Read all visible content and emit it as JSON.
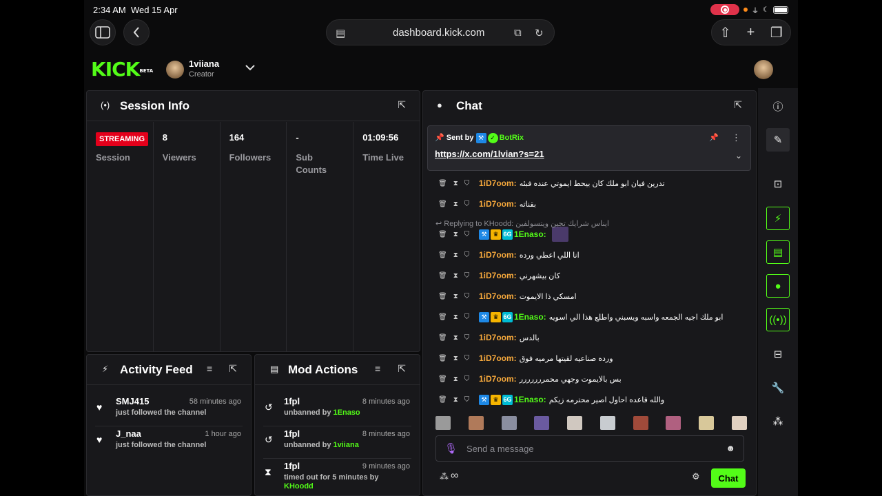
{
  "status": {
    "time": "2:34 AM",
    "date": "Wed 15 Apr"
  },
  "browser": {
    "url": "dashboard.kick.com"
  },
  "brand": {
    "logo": "KICK",
    "beta": "BETA"
  },
  "user": {
    "name": "1viiana",
    "role": "Creator"
  },
  "session": {
    "title": "Session Info",
    "stats": [
      {
        "value": "STREAMING",
        "label": "Session"
      },
      {
        "value": "8",
        "label": "Viewers"
      },
      {
        "value": "164",
        "label": "Followers"
      },
      {
        "value": "-",
        "label": "Sub Counts"
      },
      {
        "value": "01:09:56",
        "label": "Time Live"
      }
    ]
  },
  "activity": {
    "title": "Activity Feed",
    "items": [
      {
        "name": "SMJ415",
        "time": "58 minutes ago",
        "text": "just followed the channel"
      },
      {
        "name": "J_naa",
        "time": "1 hour ago",
        "text": "just followed the channel"
      }
    ]
  },
  "mod": {
    "title": "Mod Actions",
    "items": [
      {
        "name": "1fpl",
        "time": "8 minutes ago",
        "text": "unbanned by",
        "by": "1Enaso"
      },
      {
        "name": "1fpl",
        "time": "8 minutes ago",
        "text": "unbanned by",
        "by": "1viiana"
      },
      {
        "name": "1fpl",
        "time": "9 minutes ago",
        "text": "timed out for 5 minutes by",
        "by": "KHoodd"
      }
    ]
  },
  "chat": {
    "title": "Chat",
    "pinned": {
      "sent_by": "Sent by",
      "author": "BotRix",
      "link": "https://x.com/1lvian?s=21"
    },
    "reply_to": "Replying to KHoodd: ايناس شرايك تجين ويتسولفين",
    "messages": [
      {
        "user": "1iD7oom:",
        "text": "تدرين فيان ابو ملك كان بيحط ايموتي عنده فبئه",
        "badges": false
      },
      {
        "user": "1iD7oom:",
        "text": "بقناته",
        "badges": false
      },
      {
        "user": "1Enaso:",
        "text": "",
        "badges": true
      },
      {
        "user": "1iD7oom:",
        "text": "انا اللي اعطي ورده",
        "badges": false
      },
      {
        "user": "1iD7oom:",
        "text": "كان بيشهرني",
        "badges": false
      },
      {
        "user": "1iD7oom:",
        "text": "امسكي ذا الايموت",
        "badges": false
      },
      {
        "user": "1Enaso:",
        "text": "ابو ملك اجيه الجمعه واسبه ويسبني واطلع هذا الي اسويه",
        "badges": true
      },
      {
        "user": "1iD7oom:",
        "text": "بالدس",
        "badges": false
      },
      {
        "user": "1iD7oom:",
        "text": "ورده صناعيه لقيتها مرميه فوق",
        "badges": false
      },
      {
        "user": "1iD7oom:",
        "text": "بس بالايموت وجهي محمررررررر",
        "badges": false
      },
      {
        "user": "1Enaso:",
        "text": "والله قاعده احاول اصير محترمه زيكم",
        "badges": true
      }
    ],
    "input_placeholder": "Send a message",
    "send_label": "Chat",
    "infinity": "∞"
  }
}
